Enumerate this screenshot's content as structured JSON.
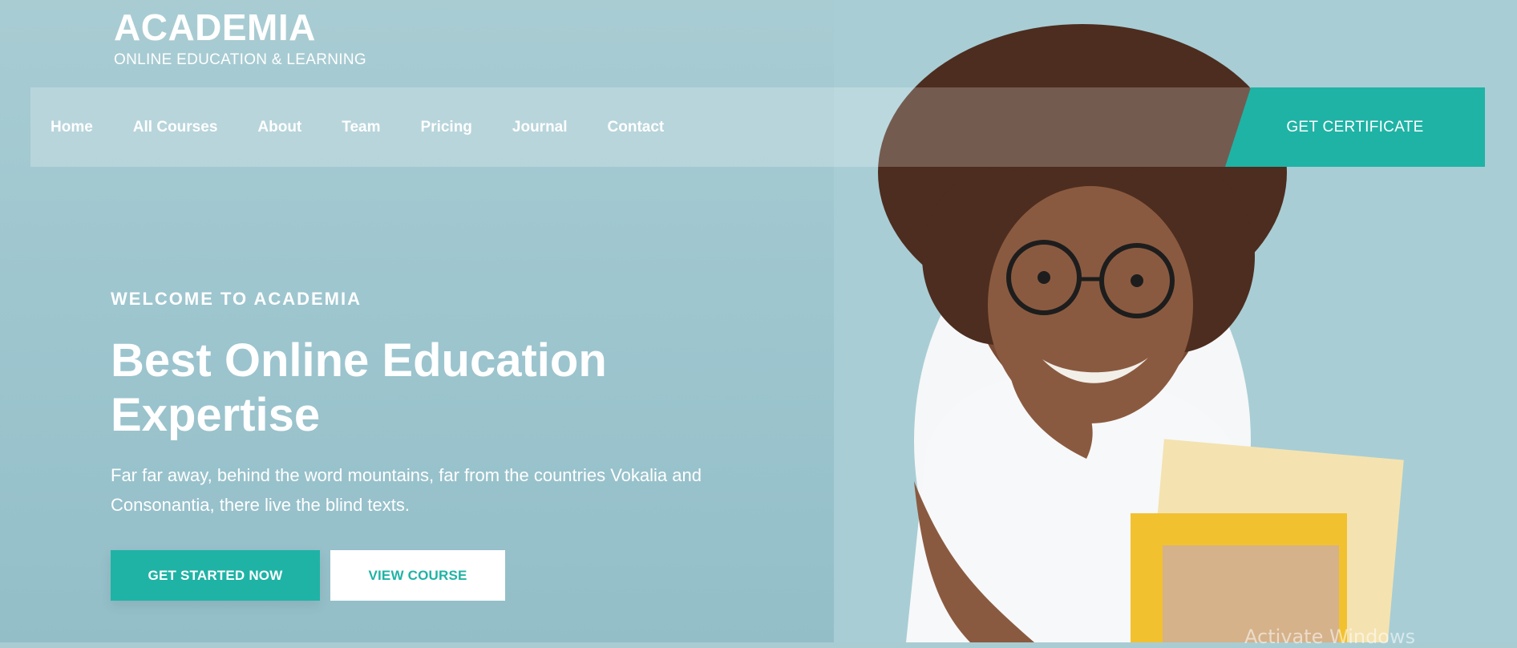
{
  "brand": {
    "name": "ACADEMIA",
    "tagline": "ONLINE EDUCATION & LEARNING"
  },
  "nav": {
    "items": [
      {
        "label": "Home"
      },
      {
        "label": "All Courses"
      },
      {
        "label": "About"
      },
      {
        "label": "Team"
      },
      {
        "label": "Pricing"
      },
      {
        "label": "Journal"
      },
      {
        "label": "Contact"
      }
    ],
    "cta": "GET CERTIFICATE"
  },
  "hero": {
    "kicker": "WELCOME TO ACADEMIA",
    "headline": "Best Online Education Expertise",
    "lede": "Far far away, behind the word mountains, far from the countries Vokalia and Consonantia, there live the blind texts.",
    "primary_button": "GET STARTED NOW",
    "secondary_button": "VIEW COURSE"
  },
  "system": {
    "watermark": "Activate Windows"
  },
  "colors": {
    "accent": "#1fb3a5",
    "background": "#a3c9d1"
  }
}
